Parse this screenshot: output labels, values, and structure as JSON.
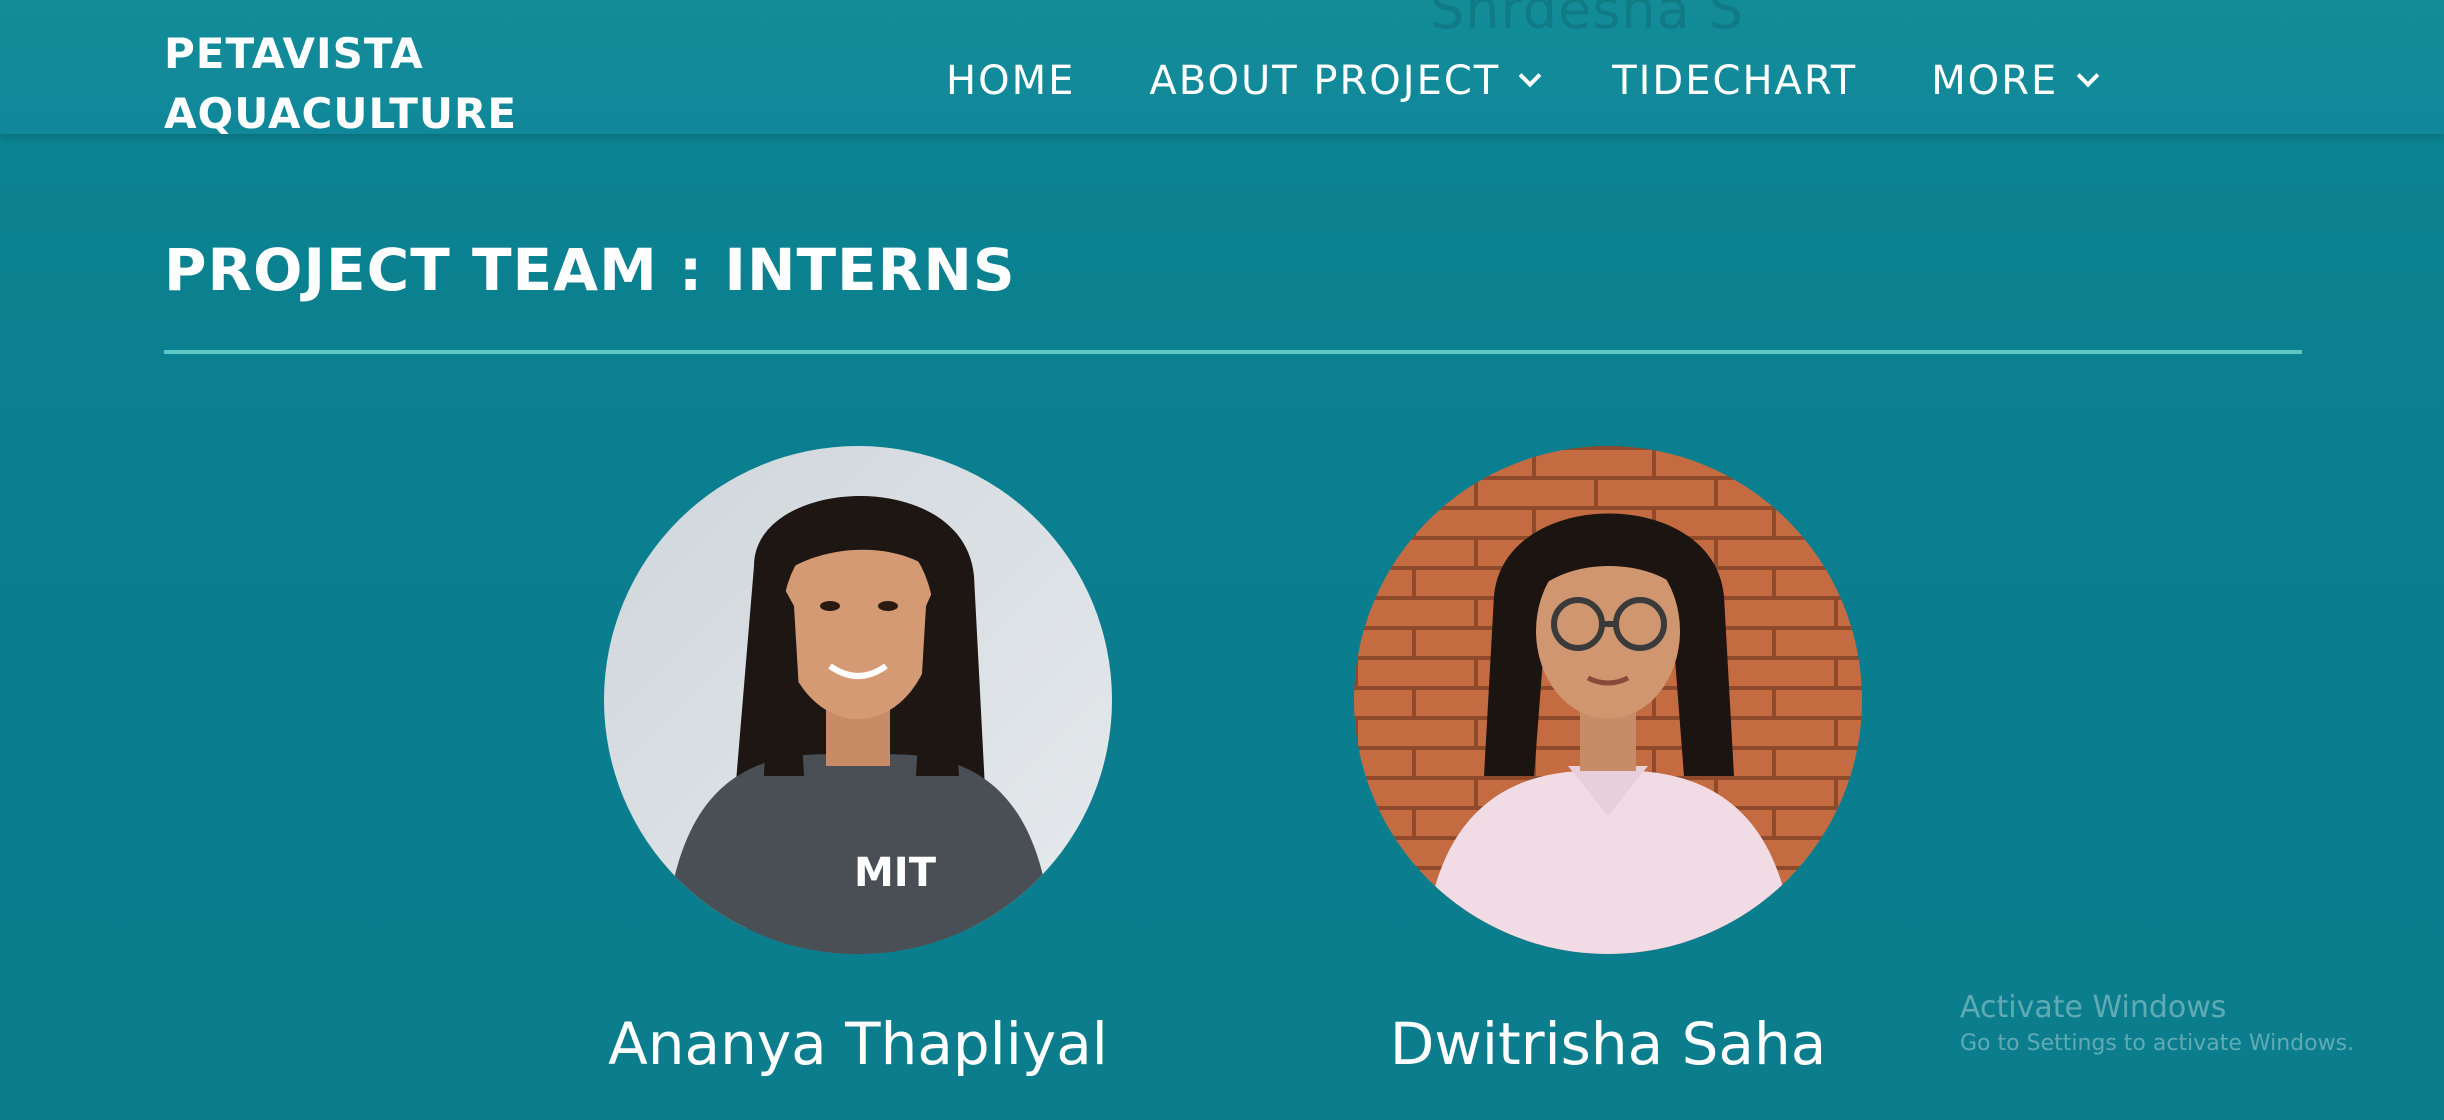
{
  "header": {
    "brand_line1": "PETAVISTA",
    "brand_line2": "AQUACULTURE",
    "ghost_text": "Shrdesha S",
    "nav": [
      {
        "label": "HOME",
        "has_dropdown": false
      },
      {
        "label": "ABOUT PROJECT",
        "has_dropdown": true
      },
      {
        "label": "TIDECHART",
        "has_dropdown": false
      },
      {
        "label": "MORE",
        "has_dropdown": true
      }
    ]
  },
  "section": {
    "title": "PROJECT TEAM : INTERNS"
  },
  "members": [
    {
      "name": "Ananya Thapliyal",
      "photo": "person-photo"
    },
    {
      "name": "Dwitrisha Saha",
      "photo": "person-photo"
    }
  ],
  "watermark": {
    "title": "Activate Windows",
    "subtitle": "Go to Settings to activate Windows."
  },
  "colors": {
    "background": "#0b7f8f",
    "header": "#10889a",
    "divider": "#5fc7c4",
    "text": "#ffffff"
  }
}
